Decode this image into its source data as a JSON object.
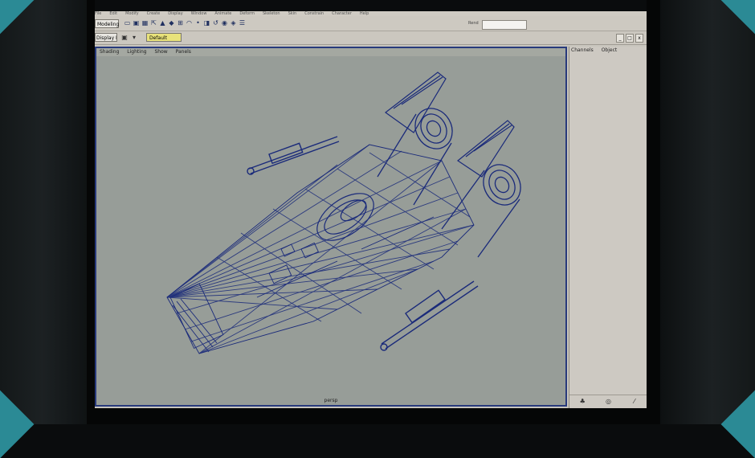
{
  "menubar": {
    "items": [
      "File",
      "Edit",
      "Modify",
      "Create",
      "Display",
      "Window",
      "Animate",
      "Deform",
      "Skeleton",
      "Skin",
      "Constrain",
      "Character",
      "Help"
    ]
  },
  "statusline": {
    "mode": "Modeling",
    "render_label": "Rend",
    "tool_icons": [
      "new-scene-icon",
      "open-scene-icon",
      "save-scene-icon",
      "select-hierarchy-icon",
      "select-object-icon",
      "select-component-icon",
      "snap-grid-icon",
      "snap-curve-icon",
      "snap-point-icon",
      "snap-view-icon",
      "history-icon",
      "render-icon",
      "ipr-icon",
      "render-globals-icon"
    ]
  },
  "shelf": {
    "layer_select": "Display Layers",
    "layer_name": "Default",
    "win_controls": [
      "_",
      "□",
      "x"
    ]
  },
  "viewport": {
    "panel_menu": [
      "Shading",
      "Lighting",
      "Show",
      "Panels"
    ],
    "camera_label": "persp"
  },
  "channelbox": {
    "header": [
      "Channels",
      "Object"
    ]
  },
  "colors": {
    "viewport_bg": "#979d98",
    "wireframe": "#1a2a7a",
    "viewport_border": "#283a7c",
    "ui_gray": "#c8c5bd",
    "layer_yellow": "#e8e27a"
  }
}
